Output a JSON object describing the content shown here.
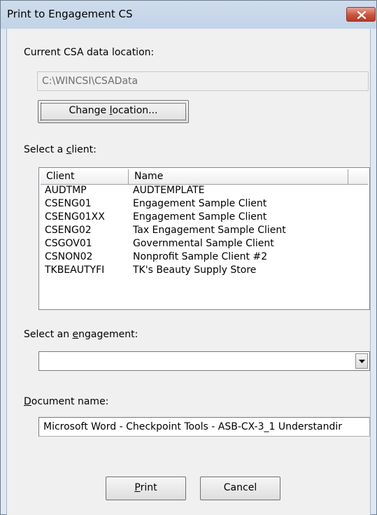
{
  "window": {
    "title": "Print to Engagement CS"
  },
  "location": {
    "label": "Current CSA data location:",
    "value": "C:\\WINCSI\\CSAData",
    "change_button": {
      "pre": "Change ",
      "hot": "l",
      "post": "ocation..."
    }
  },
  "client_section": {
    "label": {
      "pre": "Select a ",
      "hot": "c",
      "post": "lient:"
    },
    "columns": [
      "Client",
      "Name"
    ],
    "rows": [
      {
        "client": "AUDTMP",
        "name": "AUDTEMPLATE"
      },
      {
        "client": "CSENG01",
        "name": "Engagement Sample Client"
      },
      {
        "client": "CSENG01XX",
        "name": "Engagement Sample Client"
      },
      {
        "client": "CSENG02",
        "name": "Tax Engagement Sample Client"
      },
      {
        "client": "CSGOV01",
        "name": "Governmental Sample Client"
      },
      {
        "client": "CSNON02",
        "name": "Nonprofit Sample Client #2"
      },
      {
        "client": "TKBEAUTYFI",
        "name": "TK's Beauty Supply Store"
      }
    ]
  },
  "engagement": {
    "label": {
      "pre": "Select an ",
      "hot": "e",
      "post": "ngagement:"
    },
    "selected": ""
  },
  "document": {
    "label": {
      "pre": "",
      "hot": "D",
      "post": "ocument name:"
    },
    "value": "Microsoft Word - Checkpoint Tools - ASB-CX-3_1 Understandir"
  },
  "buttons": {
    "print": {
      "pre": "",
      "hot": "P",
      "post": "rint"
    },
    "cancel": "Cancel"
  },
  "icons": {
    "close": "close-icon",
    "dropdown": "chevron-down-icon"
  }
}
